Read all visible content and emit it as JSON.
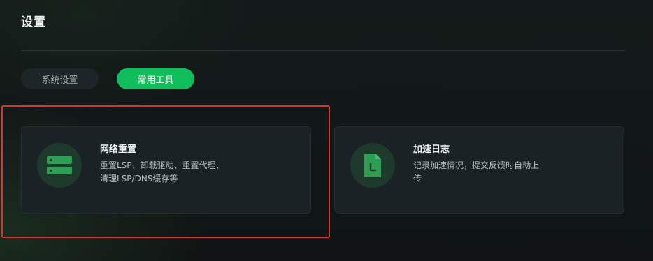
{
  "page": {
    "title": "设置"
  },
  "tabs": [
    {
      "label": "系统设置",
      "active": false
    },
    {
      "label": "常用工具",
      "active": true
    }
  ],
  "cards": [
    {
      "title": "网络重置",
      "description": "重置LSP、卸载驱动、重置代理、清理LSP/DNS缓存等",
      "icon": "server-icon"
    },
    {
      "title": "加速日志",
      "description": "记录加速情况，提交反馈时自动上传",
      "icon": "log-file-icon"
    }
  ],
  "colors": {
    "accent": "#0fbd5a",
    "highlight": "#e2332a",
    "card_background": "#1b2226",
    "icon_circle": "#1d3a2c"
  }
}
